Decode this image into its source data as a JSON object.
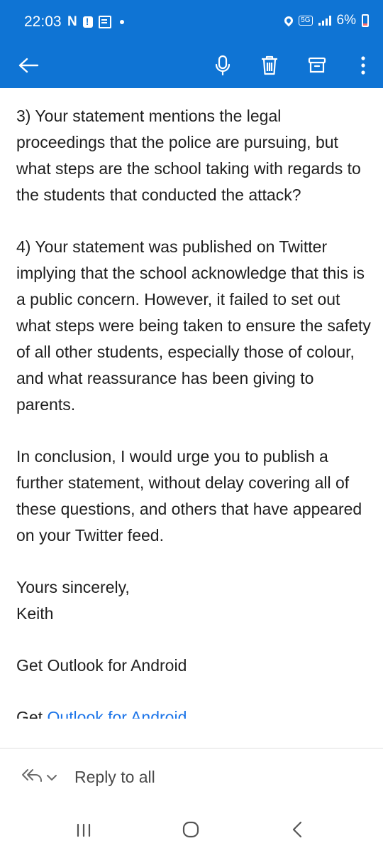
{
  "status_bar": {
    "time": "22:03",
    "network_label": "5G",
    "battery_percent": "6%",
    "colors": {
      "background": "#0f74d4"
    }
  },
  "app_bar": {
    "icons": [
      "back-arrow-icon",
      "microphone-icon",
      "trash-icon",
      "archive-icon",
      "more-vertical-icon"
    ]
  },
  "email": {
    "paragraphs": [
      "3) Your statement mentions the legal proceedings that the police are pursuing, but what steps are the school taking with regards to the students that conducted the attack?",
      "4) Your statement was published on Twitter implying that the school acknowledge that this is a public concern. However, it failed to set out what steps were being taken to ensure the safety of all other students, especially those of colour, and what reassurance has been giving to parents.",
      "In conclusion, I would urge you to publish a further statement, without delay covering all of these questions, and others that have appeared on your Twitter feed."
    ],
    "closing": "Yours sincerely,",
    "signature": "Keith",
    "footer_text": "Get Outlook for Android",
    "footer_clipped_prefix": "Get ",
    "footer_clipped_link": "Outlook for Android"
  },
  "reply_bar": {
    "label": "Reply to all"
  },
  "nav_bar": {
    "icons": [
      "recent-apps-icon",
      "home-icon",
      "back-icon"
    ]
  }
}
